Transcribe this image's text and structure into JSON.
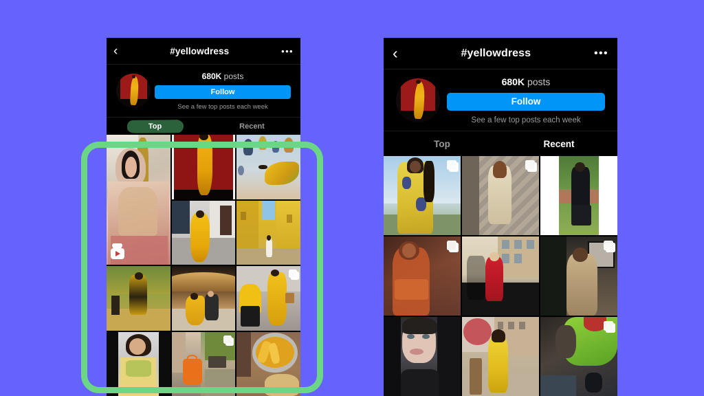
{
  "background_color": "#6563FB",
  "accent_color": "#0095F6",
  "highlight_color": "#6BD786",
  "left_phone": {
    "name": "instagram-hashtag-top-tab",
    "navbar": {
      "back_icon": "chevron-left-icon",
      "back_glyph": "‹",
      "title": "#yellowdress",
      "more_icon": "more-options-icon",
      "more_glyph": "•••"
    },
    "profile": {
      "avatar_name": "hashtag-avatar",
      "posts_count": "680K",
      "posts_label": "posts",
      "follow_label": "Follow",
      "subtitle": "See a few top posts each week"
    },
    "tabs": [
      {
        "label": "Top",
        "active": true,
        "highlighted": true
      },
      {
        "label": "Recent",
        "active": false,
        "highlighted": false
      }
    ],
    "grid": [
      {
        "id": "tile-1",
        "alt": "bride in pink embroidered lehenga",
        "badge": "reel",
        "tall": true
      },
      {
        "id": "tile-2",
        "alt": "model in yellow gown on red backdrop",
        "badge": "none",
        "tall": false
      },
      {
        "id": "tile-3",
        "alt": "hot air balloons with yellow fabric",
        "badge": "none",
        "tall": false
      },
      {
        "id": "tile-4",
        "alt": "woman in yellow gown in hotel lobby",
        "badge": "none",
        "tall": false
      },
      {
        "id": "tile-5",
        "alt": "yellow painted street alley",
        "badge": "none",
        "tall": false
      },
      {
        "id": "tile-6",
        "alt": "woman in yellow floral dress autumn leaves",
        "badge": "none",
        "tall": false
      },
      {
        "id": "tile-7",
        "alt": "couple seated on curved wooden bench",
        "badge": "none",
        "tall": false
      },
      {
        "id": "tile-8",
        "alt": "woman with yellow stroller on street",
        "badge": "carousel",
        "tall": false
      },
      {
        "id": "tile-9",
        "alt": "woman in yellow embellished outfit",
        "badge": "none",
        "tall": false
      },
      {
        "id": "tile-10",
        "alt": "orange handbag held by person",
        "badge": "carousel",
        "tall": false
      },
      {
        "id": "tile-11",
        "alt": "pan of golden french fries",
        "badge": "none",
        "tall": false
      }
    ]
  },
  "right_phone": {
    "name": "instagram-hashtag-recent-tab",
    "navbar": {
      "back_icon": "chevron-left-icon",
      "back_glyph": "‹",
      "title": "#yellowdress",
      "more_icon": "more-options-icon",
      "more_glyph": "•••"
    },
    "profile": {
      "avatar_name": "hashtag-avatar",
      "posts_count": "680K",
      "posts_label": "posts",
      "follow_label": "Follow",
      "subtitle": "See a few top posts each week"
    },
    "tabs": [
      {
        "label": "Top",
        "active": false,
        "highlighted": false
      },
      {
        "label": "Recent",
        "active": true,
        "highlighted": false
      }
    ],
    "grid": [
      {
        "id": "r-tile-1",
        "alt": "woman in yellow floral dress with braids",
        "badge": "carousel"
      },
      {
        "id": "r-tile-2",
        "alt": "woman in cream dress by stone wall",
        "badge": "carousel"
      },
      {
        "id": "r-tile-3",
        "alt": "person in black seated on grass",
        "badge": "none"
      },
      {
        "id": "r-tile-4",
        "alt": "woman in orange top indoor portrait",
        "badge": "carousel"
      },
      {
        "id": "r-tile-5",
        "alt": "woman in red dress on balcony",
        "badge": "none"
      },
      {
        "id": "r-tile-6",
        "alt": "woman in beige dress crouching indoors",
        "badge": "carousel"
      },
      {
        "id": "r-tile-7",
        "alt": "close up selfie portrait",
        "badge": "none"
      },
      {
        "id": "r-tile-8",
        "alt": "woman in yellow gown on terrace",
        "badge": "none"
      },
      {
        "id": "r-tile-9",
        "alt": "woman in green top close up",
        "badge": "carousel"
      }
    ]
  },
  "annotation": {
    "name": "green-highlight-box",
    "target": "top-tab-photo-grid"
  }
}
